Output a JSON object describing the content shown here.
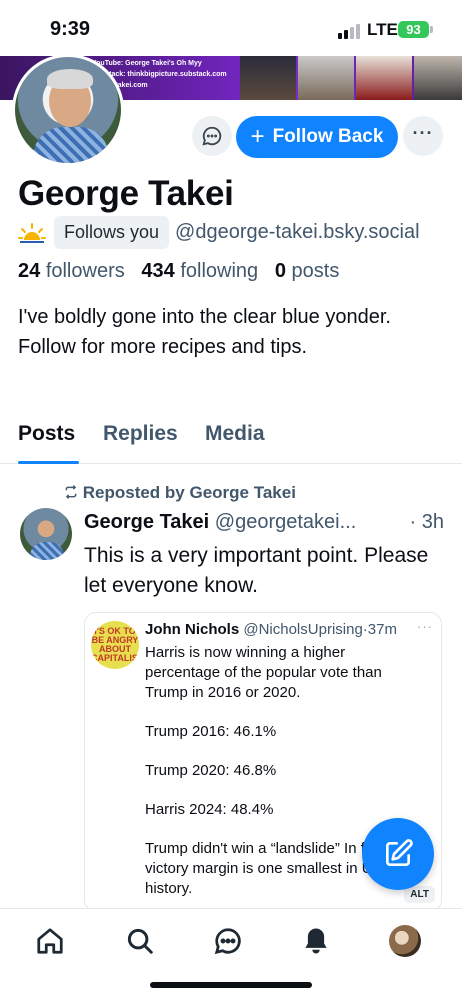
{
  "status_bar": {
    "time": "9:39",
    "network": "LTE",
    "battery": "93"
  },
  "banner": {
    "lines": [
      "YouTube: George Takei's Oh Myy",
      "Substack: thinkbigpicture.substack.com",
      "georgetakei.com"
    ]
  },
  "profile": {
    "actions": {
      "follow_back": "Follow Back",
      "follow_plus": "+",
      "more": "···"
    },
    "display_name": "George Takei",
    "follows_you": "Follows you",
    "handle": "@dgeorge-takei.bsky.social",
    "stats": {
      "followers_count": "24",
      "followers_label": "followers",
      "following_count": "434",
      "following_label": "following",
      "posts_count": "0",
      "posts_label": "posts"
    },
    "bio": "I've boldly gone into the clear blue yonder. Follow for more recipes and tips."
  },
  "tabs": [
    {
      "label": "Posts",
      "active": true
    },
    {
      "label": "Replies",
      "active": false
    },
    {
      "label": "Media",
      "active": false
    }
  ],
  "post": {
    "repost_label": "Reposted by George Takei",
    "author": "George Takei",
    "handle": "@georgetakei...",
    "time": "· 3h",
    "text": "This is a very important point. Please let everyone know.",
    "quote": {
      "avatar_text": "I'S OK TO BE ANGRY ABOUT CAPITALISM",
      "author": "John Nichols",
      "handle": "@NicholsUprising",
      "time": "·37m",
      "more": "···",
      "paragraphs": [
        "Harris is now winning a higher percentage of the popular vote than Trump in 2016 or 2020.",
        "Trump 2016: 46.1%",
        "Trump 2020: 46.8%",
        "Harris 2024: 48.4%",
        "Trump didn't win a “landslide” In fact, his victory margin is one smallest in US history."
      ],
      "alt_badge": "ALT"
    }
  },
  "icons": {
    "message": "message-icon",
    "compose": "compose-icon",
    "home": "home-icon",
    "search": "search-icon",
    "chat": "chat-icon",
    "bell": "bell-icon",
    "repost": "repost-icon",
    "sun": "sun-icon"
  },
  "colors": {
    "accent": "#1083fe",
    "secondary_text": "#42576c",
    "banner": "#6a22b0",
    "battery": "#34c759"
  }
}
